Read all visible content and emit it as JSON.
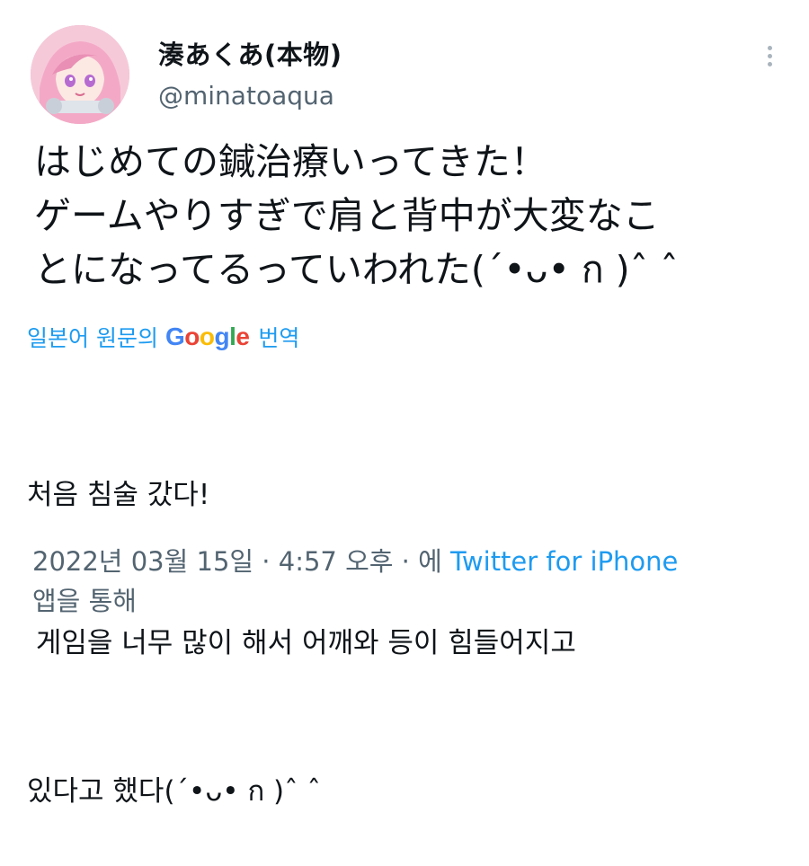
{
  "user": {
    "display_name": "湊あくあ(本物)",
    "handle": "@minatoaqua"
  },
  "tweet": {
    "lines": [
      "はじめての鍼治療いってきた！",
      "ゲームやりすぎで肩と背中が大変なこ",
      "とになってるっていわれた(´•ᴗ• ก )ˆ ˆ"
    ]
  },
  "translation": {
    "prefix": "일본어 원문의",
    "google_letters": [
      "G",
      "o",
      "o",
      "g",
      "l",
      "e"
    ],
    "suffix": "번역",
    "lines": [
      "처음 침술 갔다!",
      " 게임을 너무 많이 해서 어깨와 등이 힘들어지고",
      "있다고 했다(´•ᴗ• ก )ˆ ˆ"
    ]
  },
  "meta": {
    "date_time": "2022년 03월 15일 · 4:57 오후 · 에",
    "source": "Twitter for iPhone",
    "suffix": "앱을 통해"
  },
  "colors": {
    "link": "#1d9bf0",
    "secondary_text": "#536471",
    "primary_text": "#0f1419"
  },
  "icons": {
    "more": "vertical-dots-icon",
    "avatar": "profile-avatar"
  }
}
